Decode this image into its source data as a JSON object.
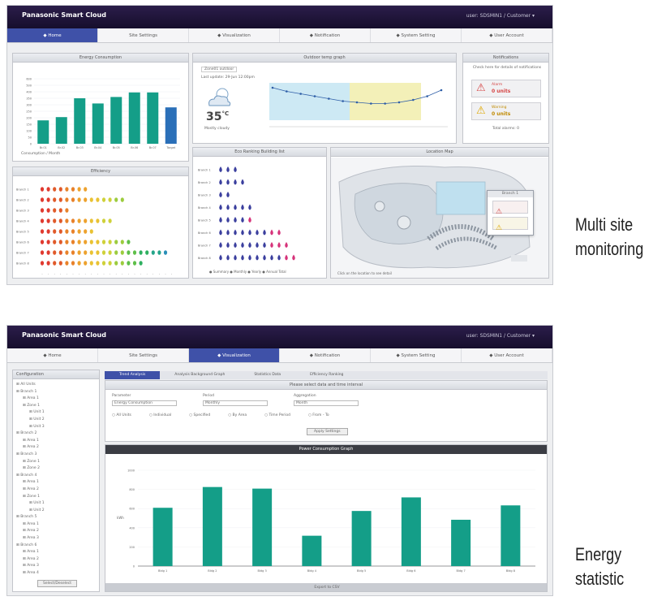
{
  "screens": [
    {
      "brand": "Panasonic Smart Cloud",
      "user": "user: SDSMIN1 / Customer ▾",
      "nav": [
        {
          "label": "◆ Home",
          "active": true
        },
        {
          "label": "Site Settings",
          "active": false
        },
        {
          "label": "◆ Visualization",
          "active": false
        },
        {
          "label": "◆ Notification",
          "active": false
        },
        {
          "label": "◆ System Setting",
          "active": false
        },
        {
          "label": "◆ User Account",
          "active": false
        }
      ],
      "panels": {
        "energy": {
          "title": "Energy Consumption",
          "yticks": [
            "600",
            "500",
            "400",
            "350",
            "300",
            "250",
            "200",
            "150",
            "100",
            "50",
            "0"
          ],
          "categories": [
            "Br.01",
            "Br.02",
            "Br.03",
            "Br.04",
            "Br.05",
            "Br.06",
            "Br.07",
            "Target"
          ],
          "values": [
            36,
            41,
            70,
            62,
            72,
            79,
            79,
            56
          ],
          "ymax": 100,
          "legend": "Consumption / Month"
        },
        "outdoor": {
          "title": "Outdoor temp graph",
          "select": "Zone01 outdoor",
          "update": "Last update: 29-Jun 12:00pm",
          "temp": "35",
          "unit": "°C",
          "condition": "Mostly cloudy",
          "line_values": [
            82,
            79,
            77,
            75,
            73,
            71,
            70,
            69,
            69,
            70,
            72,
            75,
            80
          ]
        },
        "notifications": {
          "title": "Notifications",
          "subtitle": "Check here for details of notifications",
          "alarm": {
            "label": "Alarm",
            "count": "0 units"
          },
          "warning": {
            "label": "Warning",
            "count": "0 units"
          },
          "footer": "Total alarms: 0"
        },
        "efficiency": {
          "title": "Efficiency",
          "rows": [
            {
              "label": "Branch 1",
              "n": 8
            },
            {
              "label": "Branch 2",
              "n": 14
            },
            {
              "label": "Branch 3",
              "n": 5
            },
            {
              "label": "Branch 4",
              "n": 12
            },
            {
              "label": "Branch 5",
              "n": 9
            },
            {
              "label": "Branch 6",
              "n": 15
            },
            {
              "label": "Branch 7",
              "n": 21
            },
            {
              "label": "Branch 8",
              "n": 17
            }
          ]
        },
        "ranking": {
          "title": "Eco Ranking Building list",
          "rows": [
            {
              "label": "Branch 1",
              "n": 3,
              "pink": 0
            },
            {
              "label": "Branch 2",
              "n": 4,
              "pink": 0
            },
            {
              "label": "Branch 3",
              "n": 2,
              "pink": 0
            },
            {
              "label": "Branch 4",
              "n": 5,
              "pink": 0
            },
            {
              "label": "Branch 5",
              "n": 5,
              "pink": 1
            },
            {
              "label": "Branch 6",
              "n": 9,
              "pink": 2
            },
            {
              "label": "Branch 7",
              "n": 10,
              "pink": 3
            },
            {
              "label": "Branch 8",
              "n": 11,
              "pink": 2
            }
          ],
          "legend": "● Summary ● Monthly ● Yearly ● Annual Total"
        },
        "location": {
          "title": "Location Map",
          "popup_title": "Branch 1",
          "footer": "Click on the location to see detail"
        }
      }
    },
    {
      "brand": "Panasonic Smart Cloud",
      "user": "user: SDSMIN1 / Customer ▾",
      "nav": [
        {
          "label": "◆ Home",
          "active": false
        },
        {
          "label": "Site Settings",
          "active": false
        },
        {
          "label": "◆ Visualization",
          "active": true
        },
        {
          "label": "◆ Notification",
          "active": false
        },
        {
          "label": "◆ System Setting",
          "active": false
        },
        {
          "label": "◆ User Account",
          "active": false
        }
      ],
      "tree": {
        "title": "Configuration",
        "items": [
          "All Units",
          "Branch 1",
          "Area 1",
          "Zone 1",
          "Unit 1",
          "Unit 2",
          "Unit 3",
          "Branch 2",
          "Area 1",
          "Area 2",
          "Branch 3",
          "Zone 1",
          "Zone 2",
          "Branch 4",
          "Area 1",
          "Area 2",
          "Zone 1",
          "Unit 1",
          "Unit 2",
          "Branch 5",
          "Area 1",
          "Area 2",
          "Area 3",
          "Branch 6",
          "Area 1",
          "Area 2",
          "Area 3",
          "Area 4"
        ],
        "button": "Select/Deselect"
      },
      "tabs": [
        {
          "label": "Trend Analysis",
          "active": true
        },
        {
          "label": "Analysis Background Graph",
          "active": false
        },
        {
          "label": "Statistics Data",
          "active": false
        },
        {
          "label": "Efficiency Ranking",
          "active": false
        }
      ],
      "form": {
        "header": "Please select data and time interval",
        "f1_label": "Parameter",
        "f1_value": "Energy Consumption",
        "f2_label": "Period",
        "f2_value": "Monthly",
        "f3_label": "Aggregation",
        "f3_value": "Month",
        "options": [
          "All Units",
          "Individual",
          "Specified",
          "By Area",
          "Time Period",
          "From - To"
        ],
        "button": "Apply Settings"
      },
      "chart": {
        "title": "Power Consumption Graph",
        "button": "Export to CSV",
        "ylabel": "kWh",
        "yticks": [
          "1000",
          "800",
          "600",
          "400",
          "200",
          "0"
        ],
        "categories": [
          "Bldg 1",
          "Bldg 2",
          "Bldg 3",
          "Bldg 4",
          "Bldg 5",
          "Bldg 6",
          "Bldg 7",
          "Bldg 8"
        ],
        "values": [
          73,
          99,
          97,
          38,
          69,
          86,
          58,
          76
        ],
        "ymax": 120
      }
    }
  ],
  "captions": [
    {
      "line1": "Multi site",
      "line2": "monitoring"
    },
    {
      "line1": "Energy",
      "line2": "statistic"
    }
  ],
  "chart_data": [
    {
      "type": "bar",
      "categories": [
        "Br.01",
        "Br.02",
        "Br.03",
        "Br.04",
        "Br.05",
        "Br.06",
        "Br.07",
        "Target"
      ],
      "values": [
        36,
        41,
        70,
        62,
        72,
        79,
        79,
        56
      ],
      "title": "Energy Consumption"
    },
    {
      "type": "bar",
      "categories": [
        "Bldg 1",
        "Bldg 2",
        "Bldg 3",
        "Bldg 4",
        "Bldg 5",
        "Bldg 6",
        "Bldg 7",
        "Bldg 8"
      ],
      "values": [
        73,
        99,
        97,
        38,
        69,
        86,
        58,
        76
      ],
      "title": "Power Consumption Graph"
    }
  ],
  "colors": {
    "nav_active": "#3f51a8",
    "bar_teal": "#149e88",
    "bar_blue": "#2a6fb8",
    "alarm_red": "#d64545",
    "warning_yellow": "#e0a800",
    "ranking_blue": "#3b3f9e",
    "ranking_pink": "#d6337a"
  }
}
